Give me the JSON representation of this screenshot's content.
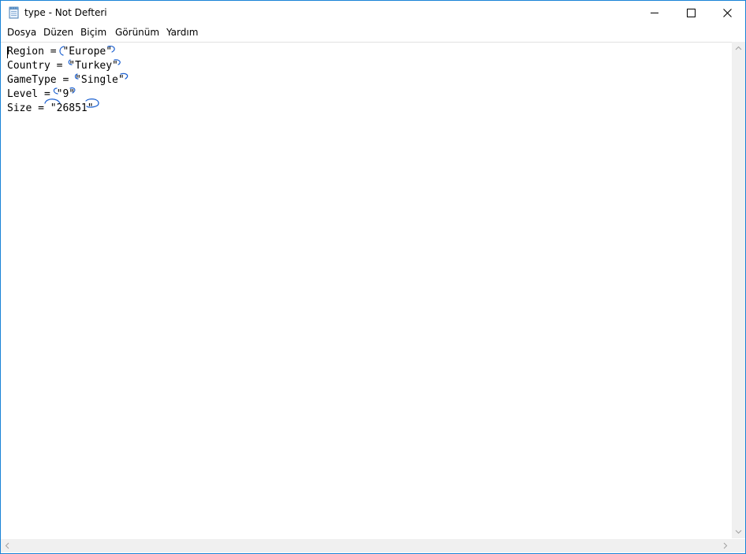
{
  "window": {
    "title": "type - Not Defteri",
    "icon": "notepad-icon",
    "accent_color": "#1883d7"
  },
  "caption_buttons": {
    "minimize_icon": "minimize-icon",
    "maximize_icon": "maximize-icon",
    "close_icon": "close-icon"
  },
  "menu": {
    "items": [
      "Dosya",
      "Düzen",
      "Biçim",
      "Görünüm",
      "Yardım"
    ]
  },
  "editor": {
    "lines": [
      "Region = \"Europe\"",
      "Country = \"Turkey\"",
      "GameType = \"Single\"",
      "Level = \"9\"",
      "Size = \"26851\""
    ],
    "annotation_color": "#1a5fd0"
  },
  "scrollbars": {
    "up_icon": "scroll-up-arrow-icon",
    "down_icon": "scroll-down-arrow-icon",
    "left_icon": "scroll-left-arrow-icon",
    "right_icon": "scroll-right-arrow-icon"
  }
}
